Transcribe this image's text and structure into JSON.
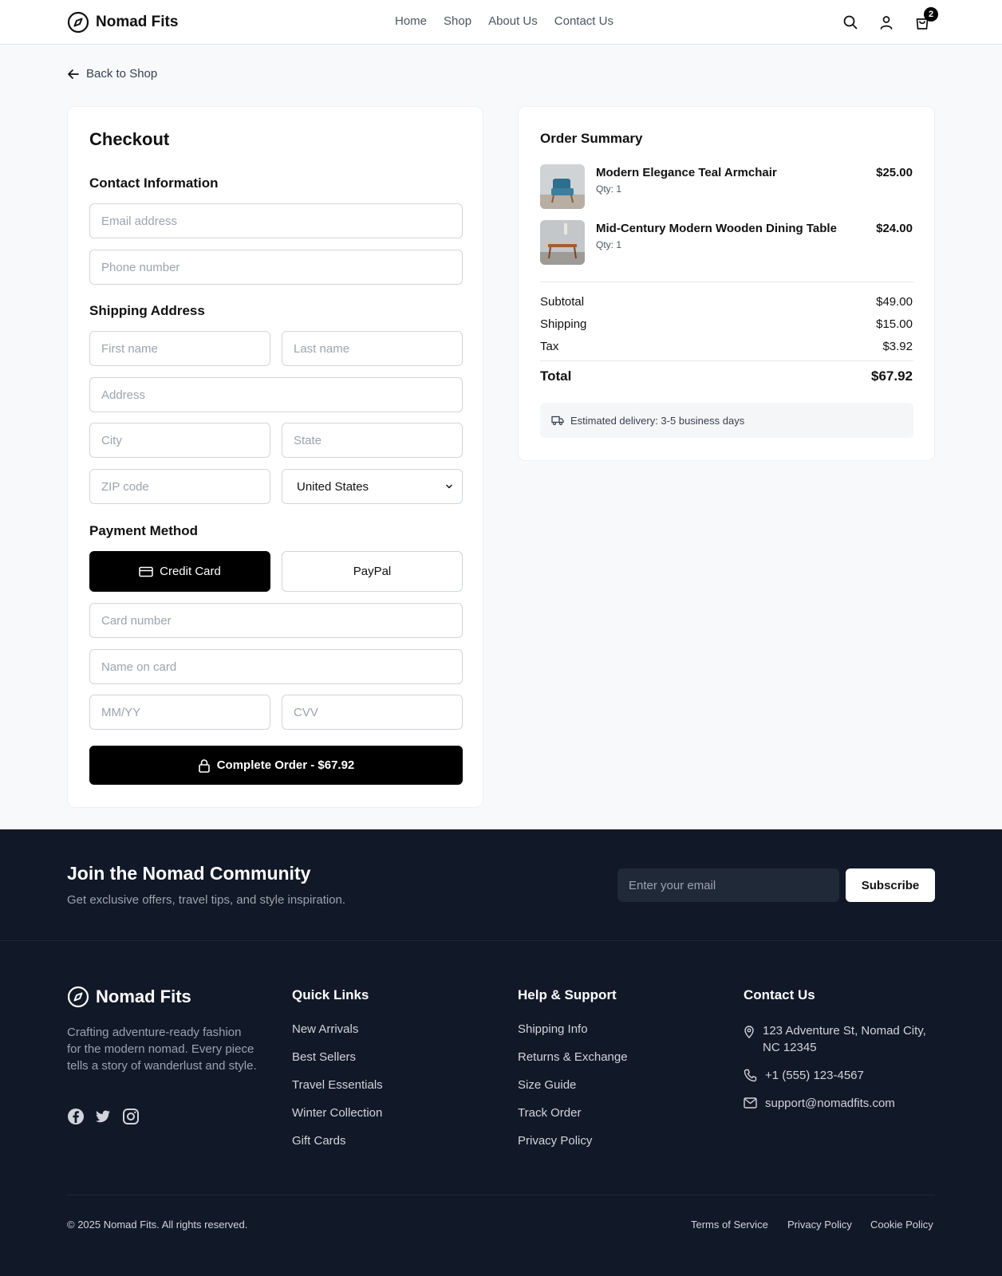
{
  "header": {
    "brand": "Nomad Fits",
    "nav": [
      "Home",
      "Shop",
      "About Us",
      "Contact Us"
    ],
    "cart_count": "2"
  },
  "back_link": "Back to Shop",
  "checkout": {
    "title": "Checkout",
    "contact_heading": "Contact Information",
    "email_placeholder": "Email address",
    "phone_placeholder": "Phone number",
    "shipping_heading": "Shipping Address",
    "first_name_placeholder": "First name",
    "last_name_placeholder": "Last name",
    "address_placeholder": "Address",
    "city_placeholder": "City",
    "state_placeholder": "State",
    "zip_placeholder": "ZIP code",
    "country_value": "United States",
    "payment_heading": "Payment Method",
    "credit_card_label": "Credit Card",
    "paypal_label": "PayPal",
    "card_number_placeholder": "Card number",
    "name_on_card_placeholder": "Name on card",
    "expiry_placeholder": "MM/YY",
    "cvv_placeholder": "CVV",
    "complete_label": "Complete Order - $67.92"
  },
  "summary": {
    "title": "Order Summary",
    "items": [
      {
        "name": "Modern Elegance Teal Armchair",
        "qty": "Qty: 1",
        "price": "$25.00"
      },
      {
        "name": "Mid-Century Modern Wooden Dining Table",
        "qty": "Qty: 1",
        "price": "$24.00"
      }
    ],
    "subtotal_label": "Subtotal",
    "subtotal": "$49.00",
    "shipping_label": "Shipping",
    "shipping": "$15.00",
    "tax_label": "Tax",
    "tax": "$3.92",
    "total_label": "Total",
    "total": "$67.92",
    "delivery": "Estimated delivery: 3-5 business days"
  },
  "footer": {
    "news_title": "Join the Nomad Community",
    "news_sub": "Get exclusive offers, travel tips, and style inspiration.",
    "news_placeholder": "Enter your email",
    "subscribe_label": "Subscribe",
    "brand": "Nomad Fits",
    "description": "Crafting adventure-ready fashion for the modern nomad. Every piece tells a story of wanderlust and style.",
    "quick_links_title": "Quick Links",
    "quick_links": [
      "New Arrivals",
      "Best Sellers",
      "Travel Essentials",
      "Winter Collection",
      "Gift Cards"
    ],
    "help_title": "Help & Support",
    "help_links": [
      "Shipping Info",
      "Returns & Exchange",
      "Size Guide",
      "Track Order",
      "Privacy Policy"
    ],
    "contact_title": "Contact Us",
    "address": "123 Adventure St, Nomad City, NC 12345",
    "phone": "+1 (555) 123-4567",
    "email": "support@nomadfits.com",
    "copyright": "© 2025 Nomad Fits. All rights reserved.",
    "legal": [
      "Terms of Service",
      "Privacy Policy",
      "Cookie Policy"
    ]
  },
  "colors": {
    "accent": "#000000",
    "footer_bg": "#111827",
    "page_bg": "#f8f9fb"
  }
}
